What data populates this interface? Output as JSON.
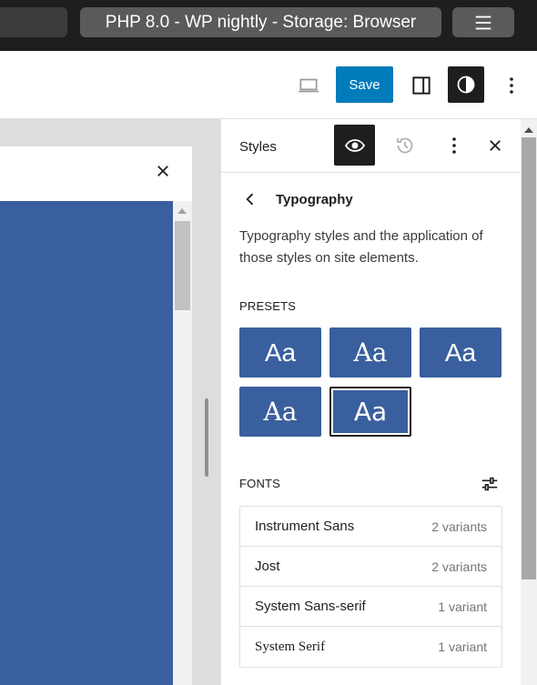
{
  "topbar": {
    "title": "PHP 8.0 - WP nightly - Storage: Browser",
    "menu_icon": "hamburger-icon"
  },
  "toolbar": {
    "save_label": "Save",
    "device_icon": "desktop-preview-icon",
    "sidebar_icon": "sidebar-toggle-icon",
    "styles_icon": "styles-contrast-icon",
    "options_icon": "vertical-ellipsis-icon",
    "accent_color": "#007cba"
  },
  "canvas": {
    "close_icon": "close-icon",
    "preview_color": "#3a5f9e"
  },
  "panel": {
    "title": "Styles",
    "eye_icon": "eye-icon",
    "history_icon": "history-icon",
    "more_icon": "vertical-ellipsis-icon",
    "close_icon": "close-icon",
    "nav": {
      "back_icon": "chevron-left-icon",
      "title": "Typography"
    },
    "description": "Typography styles and the application of those styles on site elements.",
    "presets_label": "PRESETS",
    "presets": [
      {
        "label": "Aa"
      },
      {
        "label": "Aa"
      },
      {
        "label": "Aa"
      },
      {
        "label": "Aa"
      },
      {
        "label": "Aa",
        "selected": true
      }
    ],
    "fonts_label": "FONTS",
    "fonts_icon": "sliders-settings-icon",
    "fonts": [
      {
        "name": "Instrument Sans",
        "variants": "2 variants"
      },
      {
        "name": "Jost",
        "variants": "2 variants"
      },
      {
        "name": "System Sans-serif",
        "variants": "1 variant"
      },
      {
        "name": "System Serif",
        "variants": "1 variant"
      }
    ]
  }
}
